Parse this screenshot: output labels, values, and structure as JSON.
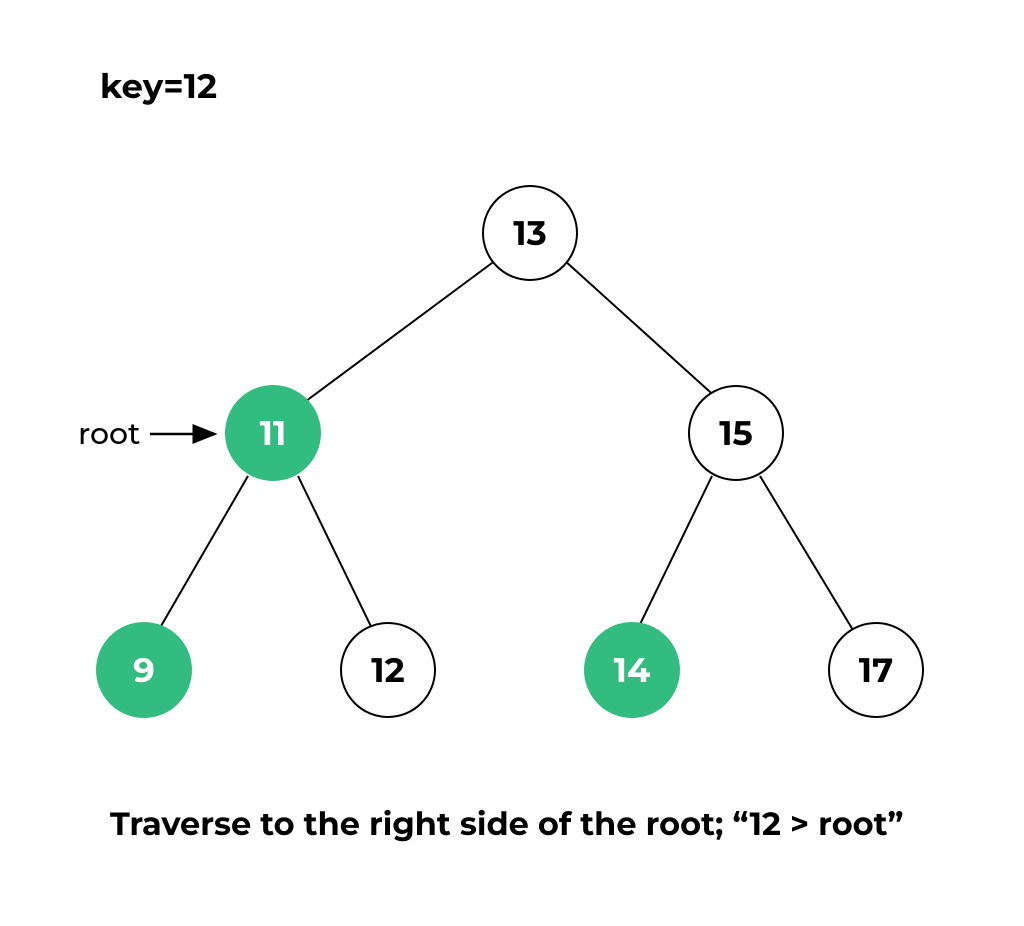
{
  "title": "key=12",
  "rootLabel": "root",
  "caption": "Traverse to the right side of the root; “12 > root”",
  "colors": {
    "green": "#32bc80",
    "black": "#000000",
    "white": "#ffffff"
  },
  "nodes": {
    "n13": {
      "value": "13",
      "highlighted": false
    },
    "n11": {
      "value": "11",
      "highlighted": true
    },
    "n15": {
      "value": "15",
      "highlighted": false
    },
    "n9": {
      "value": "9",
      "highlighted": true
    },
    "n12": {
      "value": "12",
      "highlighted": false
    },
    "n14": {
      "value": "14",
      "highlighted": true
    },
    "n17": {
      "value": "17",
      "highlighted": false
    }
  },
  "tree": {
    "root": "n13",
    "children": {
      "n13": [
        "n11",
        "n15"
      ],
      "n11": [
        "n9",
        "n12"
      ],
      "n15": [
        "n14",
        "n17"
      ]
    }
  },
  "currentRoot": "n11"
}
